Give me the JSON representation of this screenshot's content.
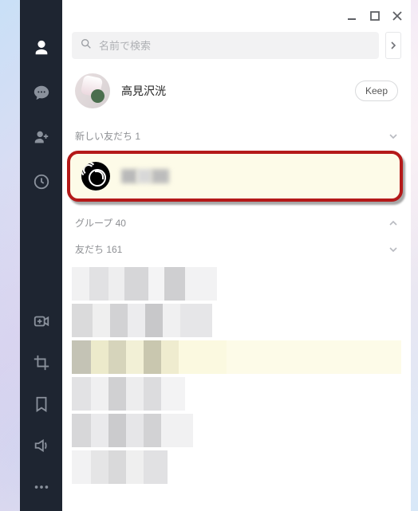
{
  "search": {
    "placeholder": "名前で検索"
  },
  "profile": {
    "name": "高見沢洸"
  },
  "keep_label": "Keep",
  "sections": {
    "new_friends": {
      "label": "新しい友だち 1"
    },
    "groups": {
      "label": "グループ 40"
    },
    "friends": {
      "label": "友だち 161"
    }
  }
}
